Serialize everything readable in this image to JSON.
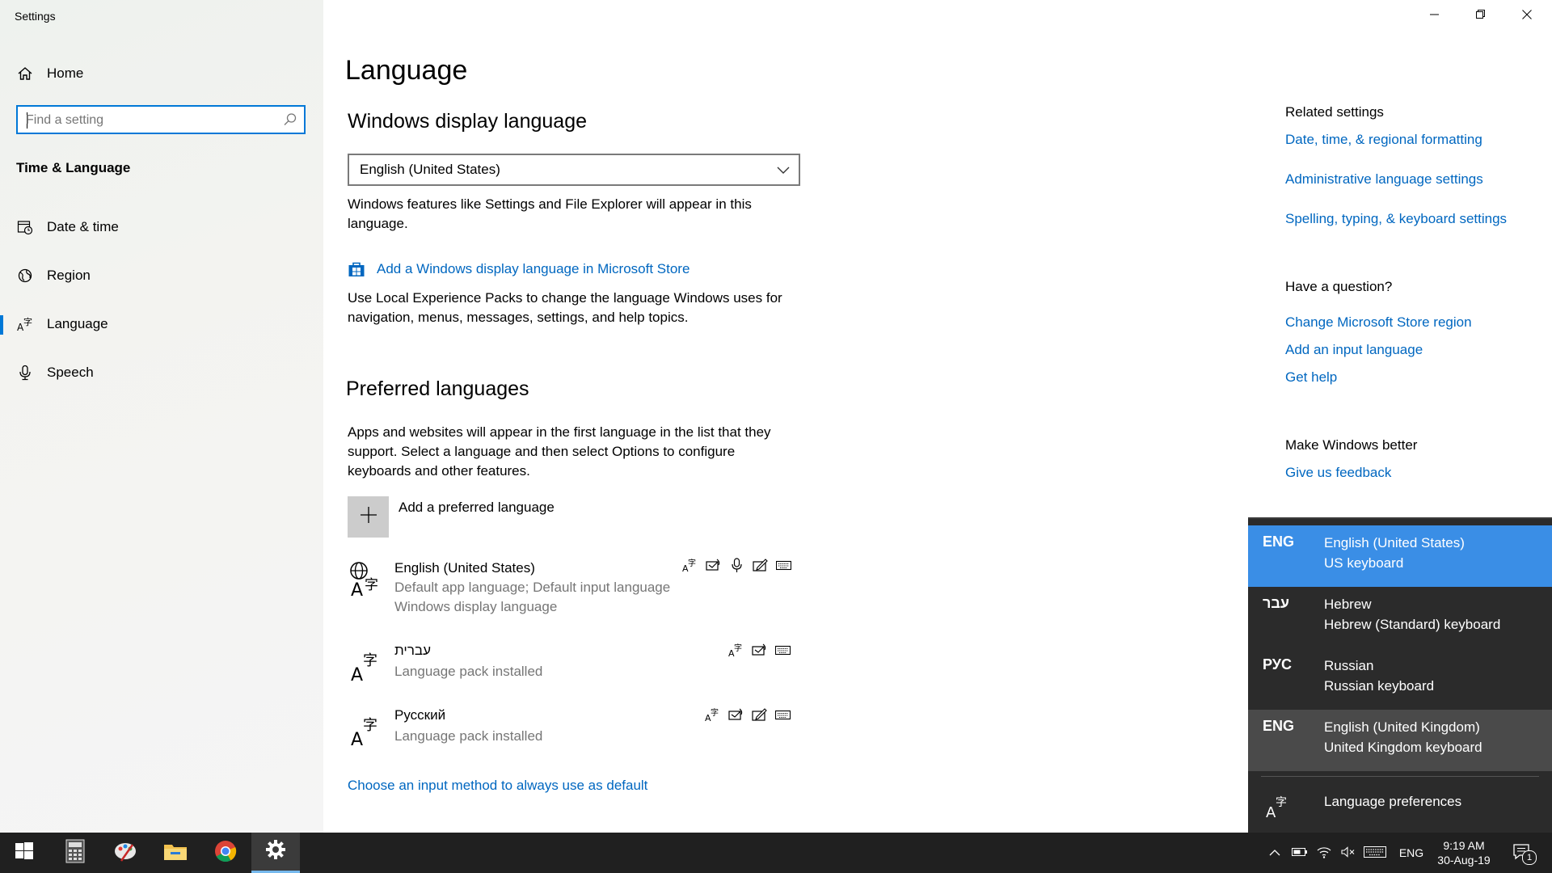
{
  "window": {
    "title": "Settings",
    "controls": {
      "minimize": "minimize-icon",
      "maximize": "restore-icon",
      "close": "close-icon"
    }
  },
  "sidebar": {
    "home_label": "Home",
    "search": {
      "placeholder": "Find a setting",
      "value": ""
    },
    "section_title": "Time & Language",
    "items": [
      {
        "label": "Date & time",
        "icon": "calendar-clock-icon"
      },
      {
        "label": "Region",
        "icon": "globe-icon"
      },
      {
        "label": "Language",
        "icon": "language-icon",
        "active": true
      },
      {
        "label": "Speech",
        "icon": "microphone-icon"
      }
    ]
  },
  "main": {
    "page_title": "Language",
    "display_language": {
      "heading": "Windows display language",
      "selected": "English (United States)",
      "description": "Windows features like Settings and File Explorer will appear in this language.",
      "store_link": "Add a Windows display language in Microsoft Store",
      "store_description": "Use Local Experience Packs to change the language Windows uses for navigation, menus, messages, settings, and help topics."
    },
    "preferred": {
      "heading": "Preferred languages",
      "description": "Apps and websites will appear in the first language in the list that they support. Select a language and then select Options to configure keyboards and other features.",
      "add_label": "Add a preferred language",
      "languages": [
        {
          "name": "English (United States)",
          "sub1": "Default app language; Default input language",
          "sub2": "Windows display language",
          "features": [
            "language-pack-icon",
            "text-to-speech-icon",
            "speech-icon",
            "handwriting-icon",
            "keyboard-icon"
          ]
        },
        {
          "name": "עברית",
          "sub1": "Language pack installed",
          "features": [
            "language-pack-icon",
            "text-to-speech-icon",
            "keyboard-icon"
          ]
        },
        {
          "name": "Русский",
          "sub1": "Language pack installed",
          "features": [
            "language-pack-icon",
            "text-to-speech-icon",
            "handwriting-icon",
            "keyboard-icon"
          ]
        }
      ],
      "input_method_link": "Choose an input method to always use as default"
    }
  },
  "related": {
    "heading": "Related settings",
    "links": [
      "Date, time, & regional formatting",
      "Administrative language settings",
      "Spelling, typing, & keyboard settings"
    ],
    "question_heading": "Have a question?",
    "question_links": [
      "Change Microsoft Store region",
      "Add an input language",
      "Get help"
    ],
    "better_heading": "Make Windows better",
    "feedback_link": "Give us feedback"
  },
  "flyout": {
    "items": [
      {
        "code": "ENG",
        "line1": "English (United States)",
        "line2": "US keyboard",
        "selected": true
      },
      {
        "code": "עבר",
        "line1": "Hebrew",
        "line2": "Hebrew (Standard) keyboard"
      },
      {
        "code": "РУС",
        "line1": "Russian",
        "line2": "Russian keyboard"
      },
      {
        "code": "ENG",
        "line1": "English (United Kingdom)",
        "line2": "United Kingdom keyboard",
        "hover": true
      }
    ],
    "preferences_label": "Language preferences",
    "colors": {
      "selected": "#3a8ee6",
      "hover": "#4a4a4a",
      "background": "#2b2b2b"
    }
  },
  "taskbar": {
    "apps": [
      "start-icon",
      "calculator-icon",
      "paint-icon",
      "file-explorer-icon",
      "chrome-icon",
      "settings-icon"
    ],
    "active_app": "settings-icon",
    "tray": {
      "input_indicator": "ENG",
      "time": "9:19 AM",
      "date": "30-Aug-19",
      "notifications": "1"
    }
  },
  "accent_color": "#0078d7",
  "link_color": "#0067c0"
}
